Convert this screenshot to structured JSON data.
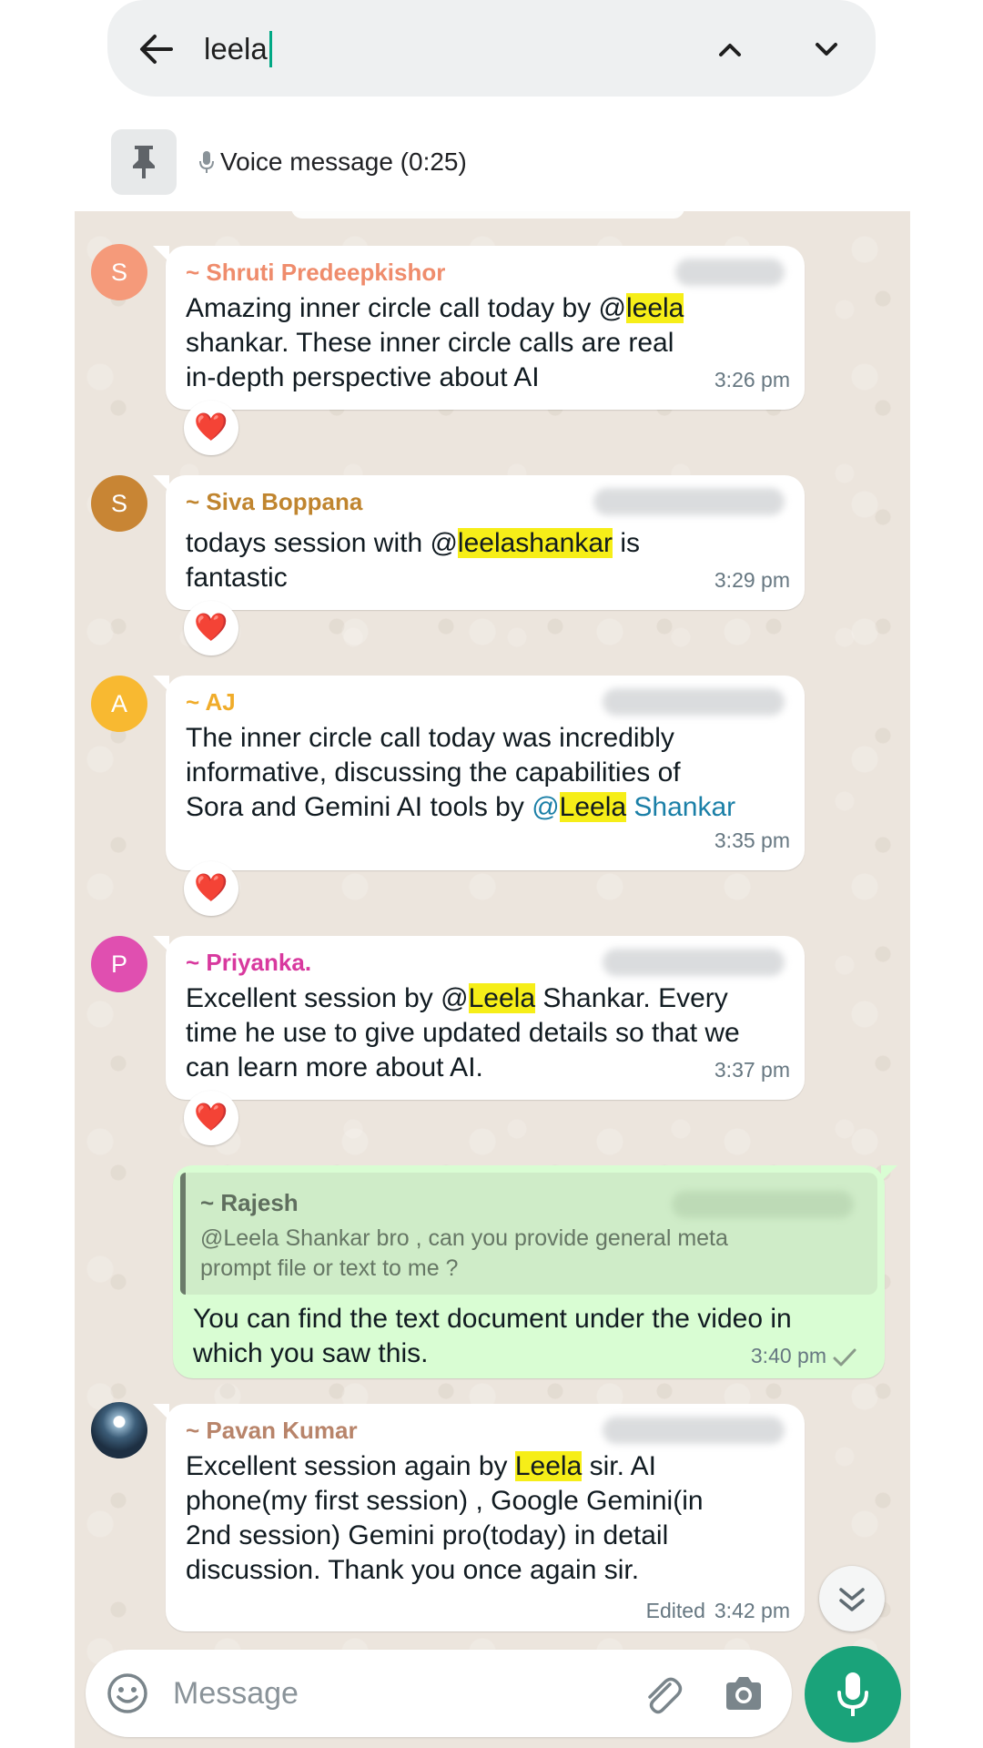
{
  "search": {
    "query": "leela"
  },
  "pinned": {
    "icon": "pin-icon",
    "text": "Voice message (0:25)"
  },
  "messages": [
    {
      "avatar_letter": "S",
      "avatar_color": "#f59a7a",
      "sender": "~ Shruti Predeepkishor",
      "sender_color": "#ef8c6c",
      "parts": [
        "Amazing inner circle call today by @",
        "leela",
        "\nshankar. These inner circle calls are real\nin-depth perspective about AI"
      ],
      "time": "3:26 pm",
      "reaction": "❤️"
    },
    {
      "avatar_letter": "S",
      "avatar_color": "#c88534",
      "sender": "~ Siva Boppana",
      "sender_color": "#c0852f",
      "parts": [
        "todays session with  @",
        "leelashankar",
        " is\nfantastic"
      ],
      "time": "3:29 pm",
      "reaction": "❤️"
    },
    {
      "avatar_letter": "A",
      "avatar_color": "#f8b931",
      "sender": "~ AJ",
      "sender_color": "#f0ac2a",
      "parts": [
        "The inner circle call today was incredibly\ninformative, discussing the capabilities of\nSora and Gemini AI tools by ",
        "@",
        "Leela",
        " Shankar"
      ],
      "time": "3:35 pm",
      "reaction": "❤️"
    },
    {
      "avatar_letter": "P",
      "avatar_color": "#e04fb0",
      "sender": "~ Priyanka.",
      "sender_color": "#d8399e",
      "parts": [
        "Excellent session by @",
        "Leela",
        " Shankar. Every\ntime he use to give updated details so that we\ncan learn more about AI."
      ],
      "time": "3:37 pm",
      "reaction": "❤️"
    },
    {
      "avatar_letter": "",
      "avatar_color": "#3c5d78",
      "sender": "~ Pavan Kumar",
      "sender_color": "#b8846a",
      "parts": [
        "Excellent session again by ",
        "Leela",
        " sir. AI\nphone(my first session) , Google Gemini(in\n2nd session) Gemini pro(today) in detail\ndiscussion. Thank you once again sir."
      ],
      "edited": "Edited",
      "time": "3:42 pm"
    }
  ],
  "outgoing": {
    "quote_sender": "~ Rajesh",
    "quote_text": "@Leela Shankar  bro , can you provide general meta\nprompt file or text to me ?",
    "text": "You can find the text document under the video in\nwhich you saw this.",
    "time": "3:40 pm"
  },
  "composer": {
    "placeholder": "Message"
  },
  "colors": {
    "highlight": "#f6ee18",
    "mention": "#1a7fa7",
    "accent": "#1aa37a",
    "outgoing_bg": "#d9fdd3"
  }
}
